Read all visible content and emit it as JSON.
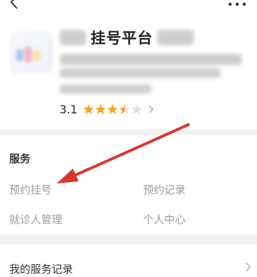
{
  "header": {
    "title": "挂号平台",
    "rating": "3.1",
    "stars": 3.5
  },
  "services": {
    "section_title": "服务",
    "items": [
      {
        "label": "预约挂号"
      },
      {
        "label": "预约记录"
      },
      {
        "label": "就诊人管理"
      },
      {
        "label": "个人中心"
      }
    ]
  },
  "records": {
    "label": "我的服务记录"
  },
  "colors": {
    "star": "#f5a623",
    "arrow": "#d9362c"
  },
  "icons": [
    "back-icon",
    "more-icon",
    "star-icon",
    "chevron-right-icon"
  ]
}
